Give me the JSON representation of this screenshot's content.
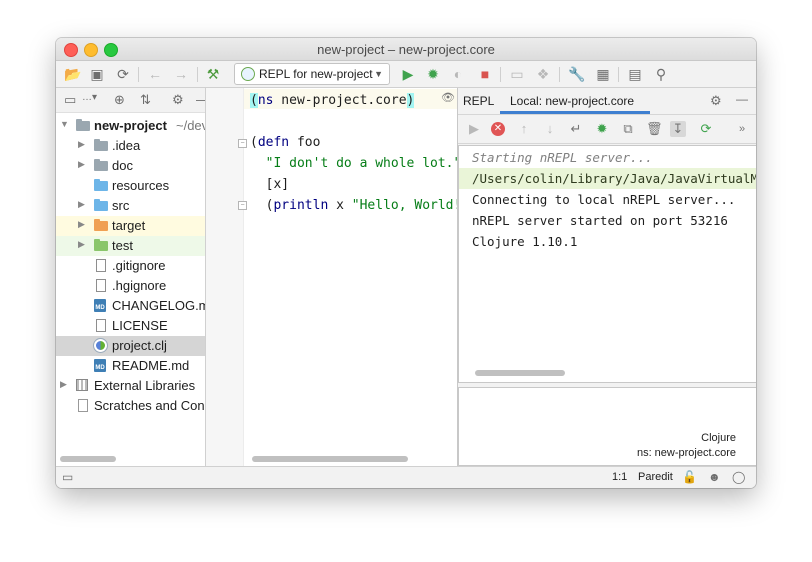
{
  "window": {
    "title": "new-project – new-project.core"
  },
  "toolbar": {
    "run_config_label": "REPL for new-project",
    "icons": [
      "open-folder-icon",
      "save-icon",
      "sync-icon",
      "back-arrow-icon",
      "forward-arrow-icon",
      "build-hammer-icon",
      "run-icon",
      "debug-icon",
      "coverage-icon",
      "stop-icon",
      "device-icon",
      "inspect-icon",
      "wrench-icon",
      "project-structure-icon",
      "terminal-icon",
      "search-icon"
    ]
  },
  "project_tree": {
    "root": {
      "name": "new-project",
      "path": "~/dev"
    },
    "items": [
      {
        "label": ".idea"
      },
      {
        "label": "doc"
      },
      {
        "label": "resources"
      },
      {
        "label": "src"
      },
      {
        "label": "target"
      },
      {
        "label": "test"
      },
      {
        "label": ".gitignore"
      },
      {
        "label": ".hgignore"
      },
      {
        "label": "CHANGELOG.md"
      },
      {
        "label": "LICENSE"
      },
      {
        "label": "project.clj"
      },
      {
        "label": "README.md"
      },
      {
        "label": "External Libraries"
      },
      {
        "label": "Scratches and Consoles"
      }
    ],
    "md_badge": "MD"
  },
  "editor": {
    "lines": [
      {
        "p1": "ns",
        "p2": " new-project.core"
      },
      {
        "text": ""
      },
      {
        "kw": "defn",
        "rest": " foo"
      },
      {
        "str": "\"I don't do a whole lot.\""
      },
      {
        "text": "[x]"
      },
      {
        "kw": "println",
        "rest": " x ",
        "str": "\"Hello, World!\""
      }
    ]
  },
  "repl": {
    "tab_label": "REPL",
    "active_tab": "Local: new-project.core",
    "output": [
      "Starting nREPL server...",
      "/Users/colin/Library/Java/JavaVirtualMachines",
      "Connecting to local nREPL server...",
      "nREPL server started on port 53216",
      "Clojure 1.10.1"
    ],
    "language": "Clojure",
    "namespace": "ns: new-project.core"
  },
  "status_bar": {
    "position": "1:1",
    "mode": "Paredit"
  }
}
